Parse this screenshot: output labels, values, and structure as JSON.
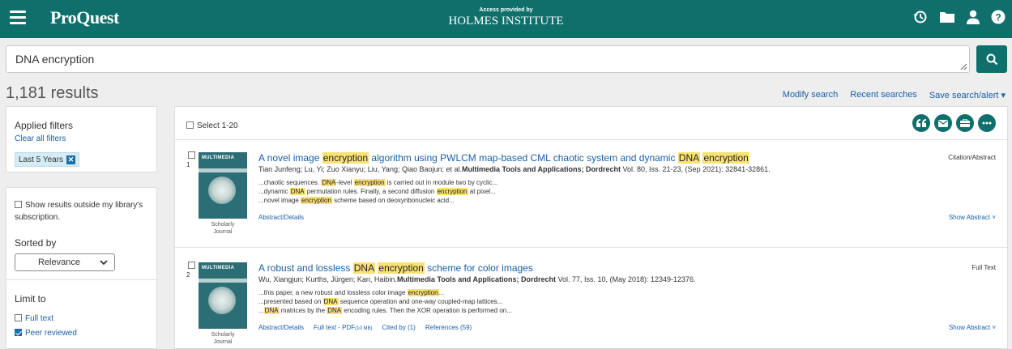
{
  "header": {
    "brand": "ProQuest",
    "access_small": "Access provided by",
    "institution": "HOLMES INSTITUTE",
    "color": "#0e6f6b"
  },
  "search": {
    "query": "DNA encryption"
  },
  "results_count": "1,181 results",
  "actions": {
    "modify": "Modify search",
    "recent": "Recent searches",
    "save": "Save search/alert ▾"
  },
  "filters": {
    "heading": "Applied filters",
    "clear": "Clear all filters",
    "chip": "Last 5 Years",
    "chip_x": "✕"
  },
  "sidebar": {
    "show_outside": "Show results outside my library's subscription.",
    "sorted_by": "Sorted by",
    "sort_value": "Relevance",
    "limit_to": "Limit to",
    "limit_full_text": "Full text",
    "limit_peer": "Peer reviewed"
  },
  "list": {
    "select_all": "Select 1-20",
    "items": [
      {
        "num": "1",
        "thumb_title": "MULTIMEDIA",
        "doctype_a": "Scholarly",
        "doctype_b": "Journal",
        "title_parts": [
          "A novel image ",
          "encryption",
          " algorithm using PWLCM map-based CML chaotic system and dynamic ",
          "DNA",
          " ",
          "encryption"
        ],
        "authors": "Tian Junfeng; Lu, Yi; Zuo Xianyu; Liu, Yang; Qiao Baojun; et al.",
        "source": "Multimedia Tools and Applications; Dordrecht",
        "details": " Vol. 80, Iss. 21-23,  (Sep 2021): 32841-32861.",
        "snippets": [
          [
            "...chaotic sequences. ",
            "DNA",
            "-level ",
            "encryption",
            " is carried out in module two by cyclic..."
          ],
          [
            "...dynamic ",
            "DNA",
            " permutation rules. Finally, a second diffusion ",
            "encryption",
            " at pixel..."
          ],
          [
            "...novel image ",
            "encryption",
            " scheme based on deoxyribonucleic acid..."
          ]
        ],
        "links": [
          "Abstract/Details"
        ],
        "badge": "Citation/Abstract",
        "show_abstract": "Show Abstract ˅"
      },
      {
        "num": "2",
        "thumb_title": "MULTIMEDIA",
        "doctype_a": "Scholarly",
        "doctype_b": "Journal",
        "title_parts": [
          "A robust and lossless ",
          "DNA",
          " ",
          "encryption",
          " scheme for color images",
          ""
        ],
        "authors": "Wu, Xiangjun; Kurths, Jürgen; Kan, Haibin.",
        "source": "Multimedia Tools and Applications; Dordrecht",
        "details": " Vol. 77, Iss. 10,  (May 2018): 12349-12376.",
        "snippets": [
          [
            "...this paper, a new robust and lossless color image ",
            "encryption",
            "..."
          ],
          [
            "...presented based on ",
            "DNA",
            " sequence operation and one-way coupled-map lattices...",
            "",
            ""
          ],
          [
            "...",
            "DNA",
            " matrices by the ",
            "DNA",
            " encoding rules. Then the XOR operation is performed on..."
          ]
        ],
        "links": [
          "Abstract/Details",
          "Full text - PDF",
          "Cited by (1)",
          "References (59)"
        ],
        "pdf_size": "(10 MB)",
        "badge": "Full Text",
        "show_abstract": "Show Abstract ˅"
      }
    ]
  }
}
